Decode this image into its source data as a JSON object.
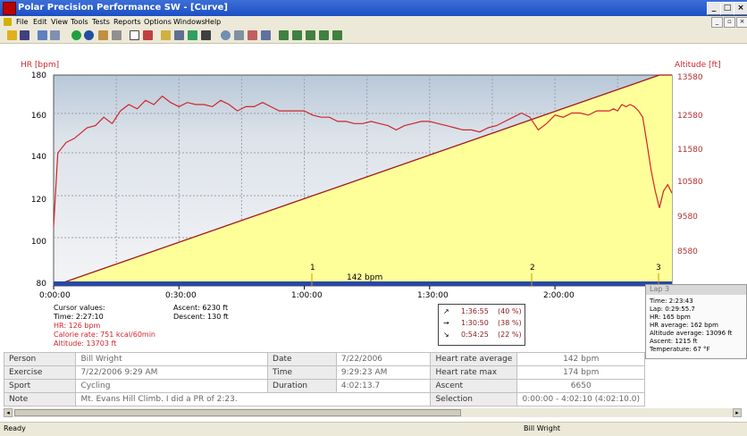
{
  "window": {
    "title": "Polar Precision Performance SW - [Curve]"
  },
  "menu": [
    "File",
    "Edit",
    "View",
    "Tools",
    "Tests",
    "Reports",
    "Options",
    "Windows",
    "Help"
  ],
  "chart_data": {
    "type": "line",
    "left_axis": {
      "label": "HR [bpm]",
      "ticks": [
        "180",
        "160",
        "140",
        "120",
        "100",
        "80"
      ],
      "range": [
        80,
        180
      ]
    },
    "right_axis": {
      "label": "Altitude [ft]",
      "ticks": [
        "13580",
        "12580",
        "11580",
        "10580",
        "9580",
        "8580"
      ]
    },
    "x_ticks": [
      "0:00:00",
      "0:30:00",
      "1:00:00",
      "1:30:00",
      "2:00:00"
    ],
    "laps": [
      "1",
      "2",
      "3"
    ],
    "hr_average_label": "142 bpm",
    "series": [
      {
        "name": "HR",
        "color": "#d0252b",
        "x_minutes": [
          0,
          1,
          3,
          5,
          8,
          10,
          12,
          14,
          16,
          18,
          20,
          22,
          24,
          26,
          28,
          30,
          32,
          34,
          36,
          38,
          40,
          42,
          44,
          46,
          48,
          50,
          52,
          54,
          56,
          58,
          60,
          62,
          64,
          66,
          68,
          70,
          72,
          74,
          76,
          78,
          80,
          82,
          84,
          86,
          88,
          90,
          92,
          94,
          96,
          98,
          100,
          102,
          104,
          106,
          108,
          110,
          112,
          114,
          116,
          118,
          120,
          122,
          124,
          126,
          128,
          130,
          132,
          133,
          134,
          135,
          136,
          137,
          138,
          139,
          140,
          141,
          142,
          143,
          144,
          145,
          146,
          147,
          148
        ],
        "y_bpm": [
          108,
          143,
          148,
          150,
          155,
          156,
          160,
          157,
          163,
          166,
          164,
          168,
          166,
          170,
          167,
          165,
          167,
          166,
          166,
          165,
          168,
          166,
          163,
          165,
          165,
          167,
          165,
          163,
          163,
          163,
          163,
          161,
          160,
          160,
          158,
          158,
          157,
          157,
          158,
          157,
          156,
          154,
          156,
          157,
          158,
          158,
          157,
          156,
          155,
          154,
          154,
          153,
          155,
          156,
          158,
          160,
          162,
          160,
          154,
          157,
          161,
          160,
          162,
          162,
          161,
          163,
          163,
          163,
          164,
          163,
          166,
          165,
          166,
          165,
          163,
          160,
          148,
          135,
          125,
          117,
          125,
          128,
          124
        ]
      },
      {
        "name": "Altitude",
        "color": "#a01818",
        "start": 8000,
        "end": 13703,
        "x_minutes": [
          0,
          145
        ]
      }
    ]
  },
  "cursor_values": {
    "header": "Cursor values:",
    "time": "Time: 2:27:10",
    "hr": "HR: 126 bpm",
    "calorie": "Calorie rate: 751 kcal/60min",
    "altitude": "Altitude: 13703 ft",
    "ascent": "Ascent: 6230 ft",
    "descent": "Descent: 130 ft"
  },
  "trend_zones": [
    {
      "arrow": "↗",
      "time": "1:36:55",
      "pct": "(40 %)"
    },
    {
      "arrow": "→",
      "time": "1:30:50",
      "pct": "(38 %)"
    },
    {
      "arrow": "↘",
      "time": "0:54:25",
      "pct": "(22 %)"
    }
  ],
  "tooltip": {
    "title": "Lap 3",
    "lines": [
      "Time: 2:23:43",
      "Lap: 0:29:55.7",
      "HR: 165 bpm",
      "HR average: 162 bpm",
      "Altitude average: 13096 ft",
      "Ascent: 1215 ft",
      "Temperature: 67 °F"
    ]
  },
  "table": {
    "rows": [
      [
        "Person",
        "Bill Wright",
        "Date",
        "7/22/2006",
        "Heart rate average",
        "142 bpm"
      ],
      [
        "Exercise",
        "7/22/2006 9:29 AM",
        "Time",
        "9:29:23 AM",
        "Heart rate max",
        "174 bpm"
      ],
      [
        "Sport",
        "Cycling",
        "Duration",
        "4:02:13.7",
        "Ascent",
        "6650"
      ],
      [
        "Note",
        "Mt. Evans Hill Climb. I did a PR of 2:23.",
        "",
        "",
        "Selection",
        "0:00:00 - 4:02:10 (4:02:10.0)"
      ]
    ]
  },
  "status": {
    "left": "Ready",
    "user": "Bill Wright"
  }
}
